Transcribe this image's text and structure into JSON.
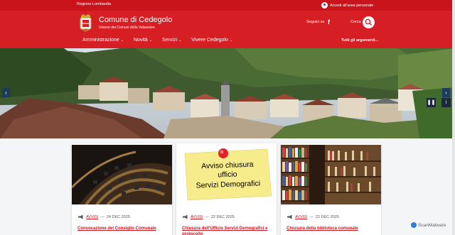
{
  "topbar": {
    "region_label": "Regione Lombardia",
    "login_label": "Accedi all'area personale"
  },
  "header": {
    "title": "Comune di Cedegolo",
    "subtitle": "Unione dei Comuni della Valsaviore",
    "follow_label": "Seguici su",
    "search_label": "Cerca",
    "all_topics": "Tutti gli argomenti..."
  },
  "nav": {
    "items": [
      {
        "label": "Amministrazione"
      },
      {
        "label": "Novità"
      },
      {
        "label": "Servizi"
      },
      {
        "label": "Vivere Cedegolo"
      }
    ]
  },
  "hero": {
    "prev_icon": "chevron-left-icon",
    "next_icon": "chevron-right-icon"
  },
  "cards": [
    {
      "category": "AVVISI",
      "date": "24 DEC 2025",
      "title": "Convocazione del Consiglio Comunale"
    },
    {
      "category": "AVVISI",
      "date": "22 DEC 2025",
      "title": "Chiusura dell'Ufficio Servizi Demografici e protocollo",
      "image_text": [
        "Avviso chiusura",
        "ufficio",
        "Servizi Demografici"
      ]
    },
    {
      "category": "AVVISI",
      "date": "22 DEC 2025",
      "title": "Chiusura della biblioteca comunale"
    }
  ],
  "watermark": "ScanMalware",
  "colors": {
    "brand_red": "#d51f25",
    "dark_red": "#c9141b"
  }
}
